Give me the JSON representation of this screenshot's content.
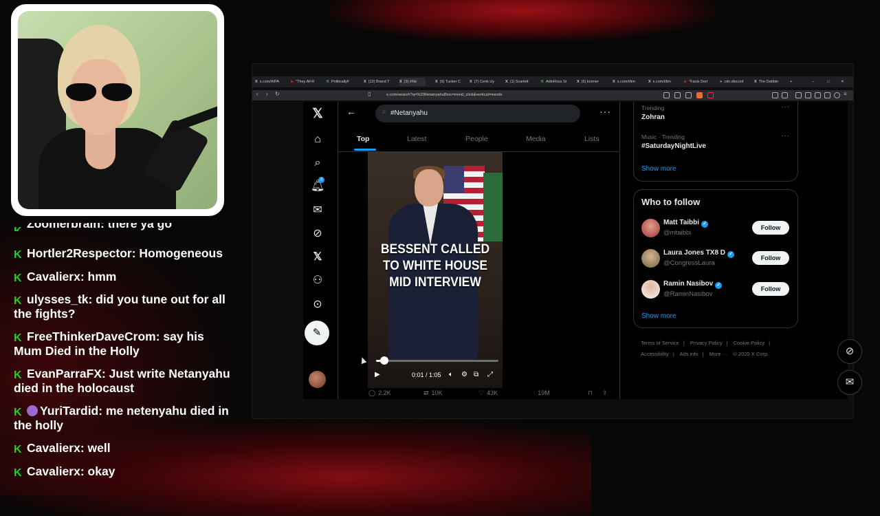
{
  "webcam": {
    "description_hidden": ""
  },
  "chat": {
    "messages": [
      {
        "user": "Zoomerbrain:",
        "text": "there ya go"
      },
      {
        "user": "Hortler2Respector:",
        "text": "Homogeneous"
      },
      {
        "user": "Cavalierx:",
        "text": "hmm"
      },
      {
        "user": "ulysses_tk:",
        "text": "did you tune out for all the fights?"
      },
      {
        "user": "FreeThinkerDaveCrom:",
        "text": "say his Mum Died in the Holly"
      },
      {
        "user": "EvanParraFX:",
        "text": "Just write Netanyahu died in the holocaust"
      },
      {
        "user": "YuriTardid:",
        "text": "me netenyahu died in the holly"
      },
      {
        "user": "Cavalierx:",
        "text": "well"
      },
      {
        "user": "Cavalierx:",
        "text": "okay"
      }
    ]
  },
  "browser": {
    "tabs": [
      {
        "label": "x.com/AIPA"
      },
      {
        "label": "\"They All R"
      },
      {
        "label": "PoliticallyF"
      },
      {
        "label": "(13) Brand T"
      },
      {
        "label": "(3) #Ne"
      },
      {
        "label": "(9) Tucker C"
      },
      {
        "label": "(7) Cenk Uy"
      },
      {
        "label": "(1) Scarlett"
      },
      {
        "label": "AdinRoss St"
      },
      {
        "label": "(6) loomer"
      },
      {
        "label": "x.com/i/tim"
      },
      {
        "label": "x.com/i/tim"
      },
      {
        "label": "\"Facts Don'"
      },
      {
        "label": "cdn.discord"
      },
      {
        "label": "The Dabbin"
      }
    ],
    "url": "x.com/search?q=%23NetanyahuBsrc=trend_click&vertical=trends"
  },
  "x": {
    "search": {
      "value": "#Netanyahu"
    },
    "tabs": [
      "Top",
      "Latest",
      "People",
      "Media",
      "Lists"
    ],
    "active_tab": "Top",
    "notif_count": "3",
    "video": {
      "caption_lines": [
        "BESSENT CALLED",
        "TO WHITE HOUSE",
        "MID INTERVIEW"
      ],
      "time": "0:01 / 1:05",
      "progress_fraction": 0.07
    },
    "post_stats": {
      "replies": "2.2K",
      "reposts": "10K",
      "likes": "43K",
      "views": "19M"
    },
    "trending": [
      {
        "category": "Trending",
        "name": "Zohran"
      },
      {
        "category": "Music · Trending",
        "name": "#SaturdayNightLive"
      }
    ],
    "show_more": "Show more",
    "who_to_follow": {
      "title": "Who to follow",
      "accounts": [
        {
          "name": "Matt Taibbi",
          "handle": "@mtaibbi",
          "button": "Follow"
        },
        {
          "name": "Laura Jones TX8 D",
          "handle": "@CongressLaura",
          "button": "Follow"
        },
        {
          "name": "Ramin Nasibov",
          "handle": "@RaminNasibov",
          "button": "Follow"
        }
      ],
      "show_more": "Show more"
    },
    "footer": [
      "Terms of Service",
      "|",
      "Privacy Policy",
      "|",
      "Cookie Policy",
      "|",
      "Accessibility",
      "|",
      "Ads info",
      "|",
      "More ···",
      "© 2025 X Corp."
    ]
  },
  "colors": {
    "accent": "#1d9bf0",
    "chat_badge": "#1ed31e",
    "bg": "#000000"
  }
}
